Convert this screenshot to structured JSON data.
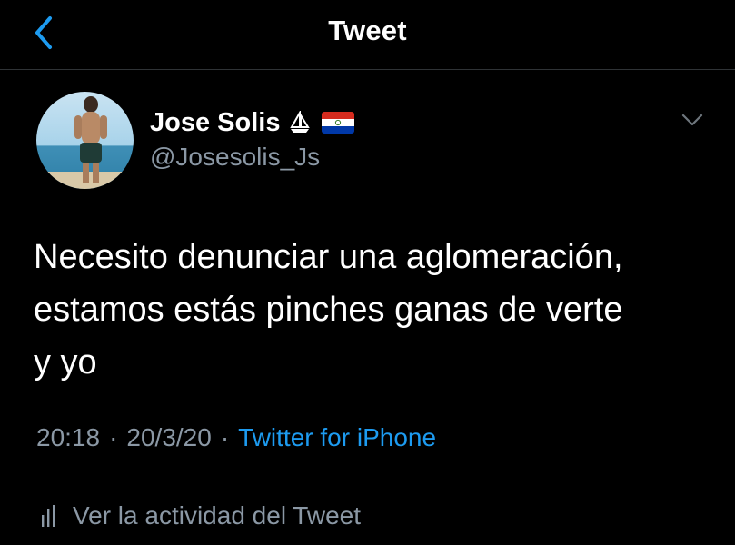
{
  "header": {
    "title": "Tweet",
    "back_icon": "chevron-left-icon"
  },
  "tweet": {
    "author": {
      "name": "Jose Solis",
      "handle": "@Josesolis_Js",
      "name_emoji": [
        "sailboat-icon",
        "paraguay-flag-icon"
      ]
    },
    "text": "Necesito denunciar una aglomeración,\nestamos estás pinches ganas de verte\ny yo",
    "time": "20:18",
    "date": "20/3/20",
    "separator": "·",
    "source": "Twitter for iPhone",
    "activity_label": "Ver la actividad del Tweet",
    "menu_icon": "chevron-down-icon"
  },
  "colors": {
    "background": "#000000",
    "text": "#ffffff",
    "secondary": "#8b98a5",
    "accent": "#1d9bf0",
    "divider": "#2f3336"
  }
}
